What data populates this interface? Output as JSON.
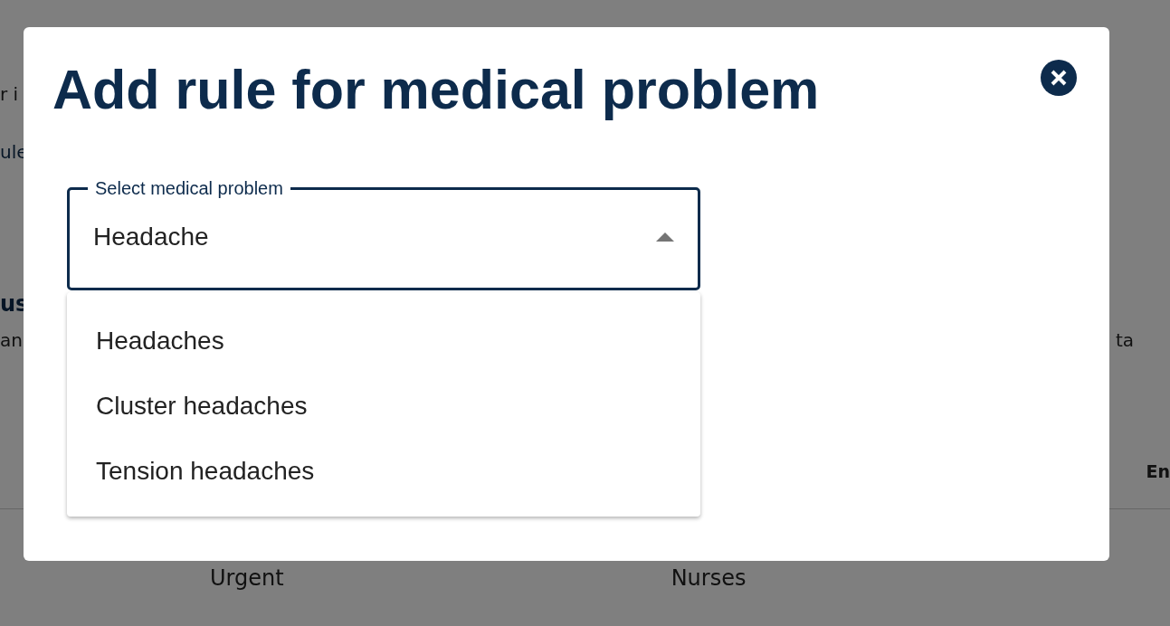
{
  "background": {
    "line_1": "r i",
    "line_2": "ule",
    "heading": "us",
    "line_3_left": "an",
    "line_3_right": "ta",
    "column_heading": "En",
    "row_cells": [
      "Urgent",
      "Nurses"
    ]
  },
  "dialog": {
    "title": "Add rule for medical problem",
    "select": {
      "label": "Select medical problem",
      "value": "Headache",
      "expanded": true,
      "options": [
        "Headaches",
        "Cluster headaches",
        "Tension headaches"
      ]
    }
  }
}
